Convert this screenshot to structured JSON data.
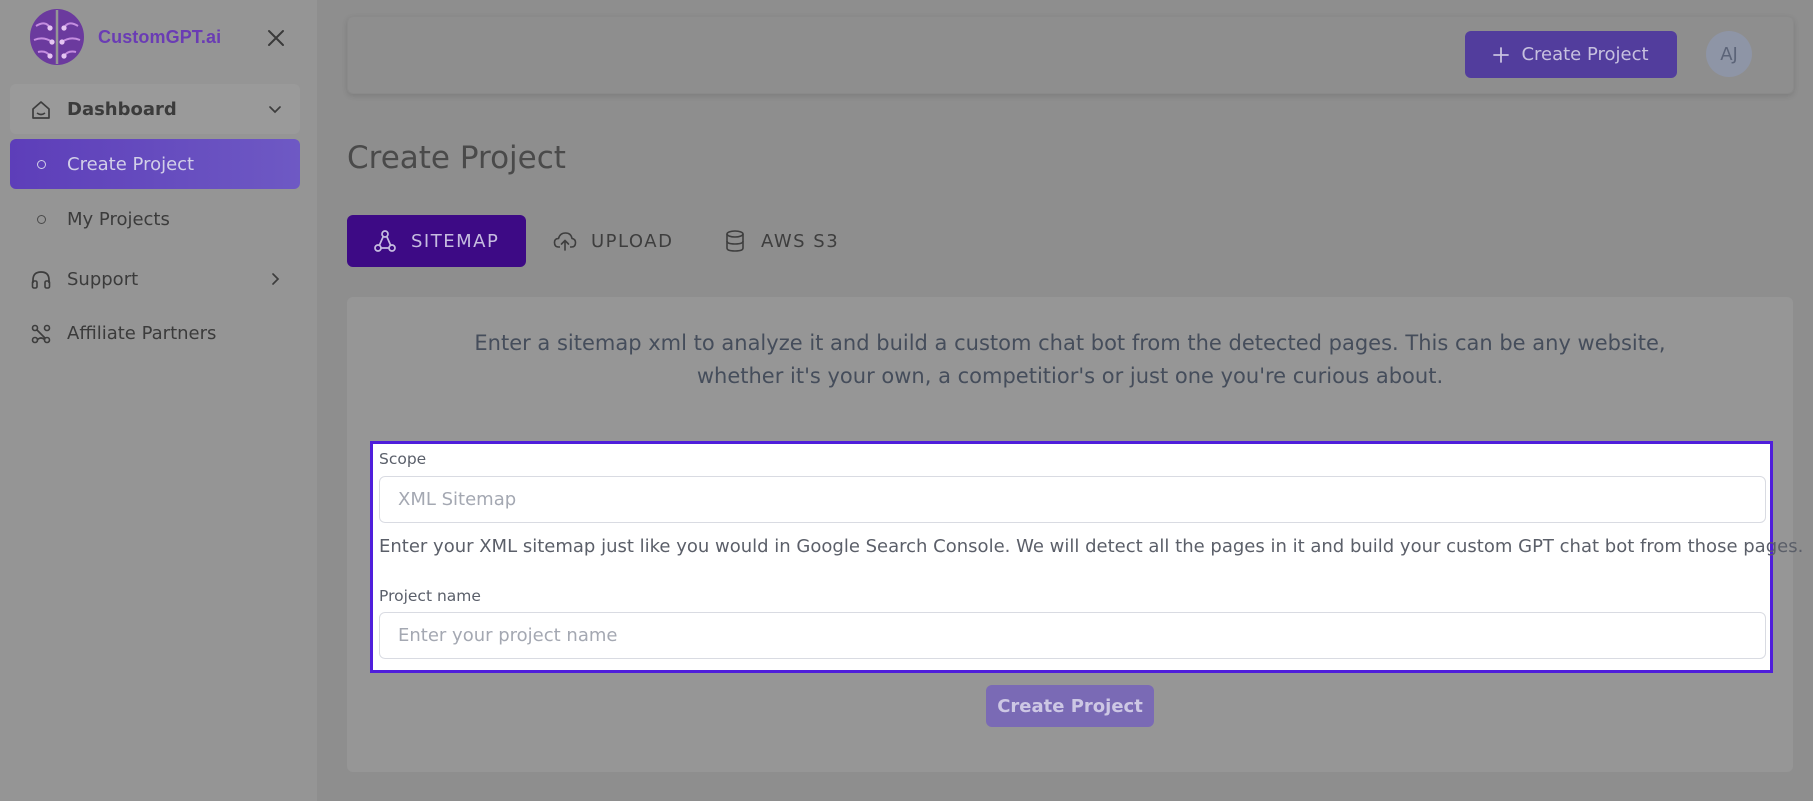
{
  "brand": {
    "name": "CustomGPT.ai",
    "logo_icon": "brain-circuit-logo",
    "colors": {
      "logo_primary": "#7b3fb8",
      "logo_secondary": "#5f3bb0"
    }
  },
  "sidebar": {
    "close_icon": "close-icon",
    "items": [
      {
        "label": "Dashboard",
        "icon": "home-icon",
        "expand_icon": "chevron-down-icon"
      },
      {
        "label": "Create Project",
        "icon": "circle-bullet-icon",
        "active": true
      },
      {
        "label": "My Projects",
        "icon": "circle-bullet-icon"
      },
      {
        "label": "Support",
        "icon": "headset-icon",
        "expand_icon": "chevron-right-icon"
      },
      {
        "label": "Affiliate Partners",
        "icon": "affiliate-network-icon"
      }
    ]
  },
  "header": {
    "create_button_label": "Create Project",
    "create_button_icon": "plus-icon",
    "avatar_initials": "AJ"
  },
  "page": {
    "title": "Create Project"
  },
  "tabs": [
    {
      "label": "SITEMAP",
      "icon": "sitemap-icon",
      "active": true
    },
    {
      "label": "UPLOAD",
      "icon": "cloud-upload-icon"
    },
    {
      "label": "AWS S3",
      "icon": "database-icon"
    }
  ],
  "form": {
    "intro_line1": "Enter a sitemap xml to analyze it and build a custom chat bot from the detected pages. This can be any website,",
    "intro_line2": "whether it's your own, a competitior's or just one you're curious about.",
    "scope_label": "Scope",
    "scope_placeholder": "XML Sitemap",
    "scope_value": "",
    "scope_help": "Enter your XML sitemap just like you would in Google Search Console. We will detect all the pages in it and build your custom GPT chat bot from those pages.",
    "project_name_label": "Project name",
    "project_name_placeholder": "Enter your project name",
    "project_name_value": "",
    "submit_label": "Create Project"
  },
  "colors": {
    "accent": "#3d0a85",
    "highlight_border": "#4f1edb",
    "button": "#523d9d"
  }
}
